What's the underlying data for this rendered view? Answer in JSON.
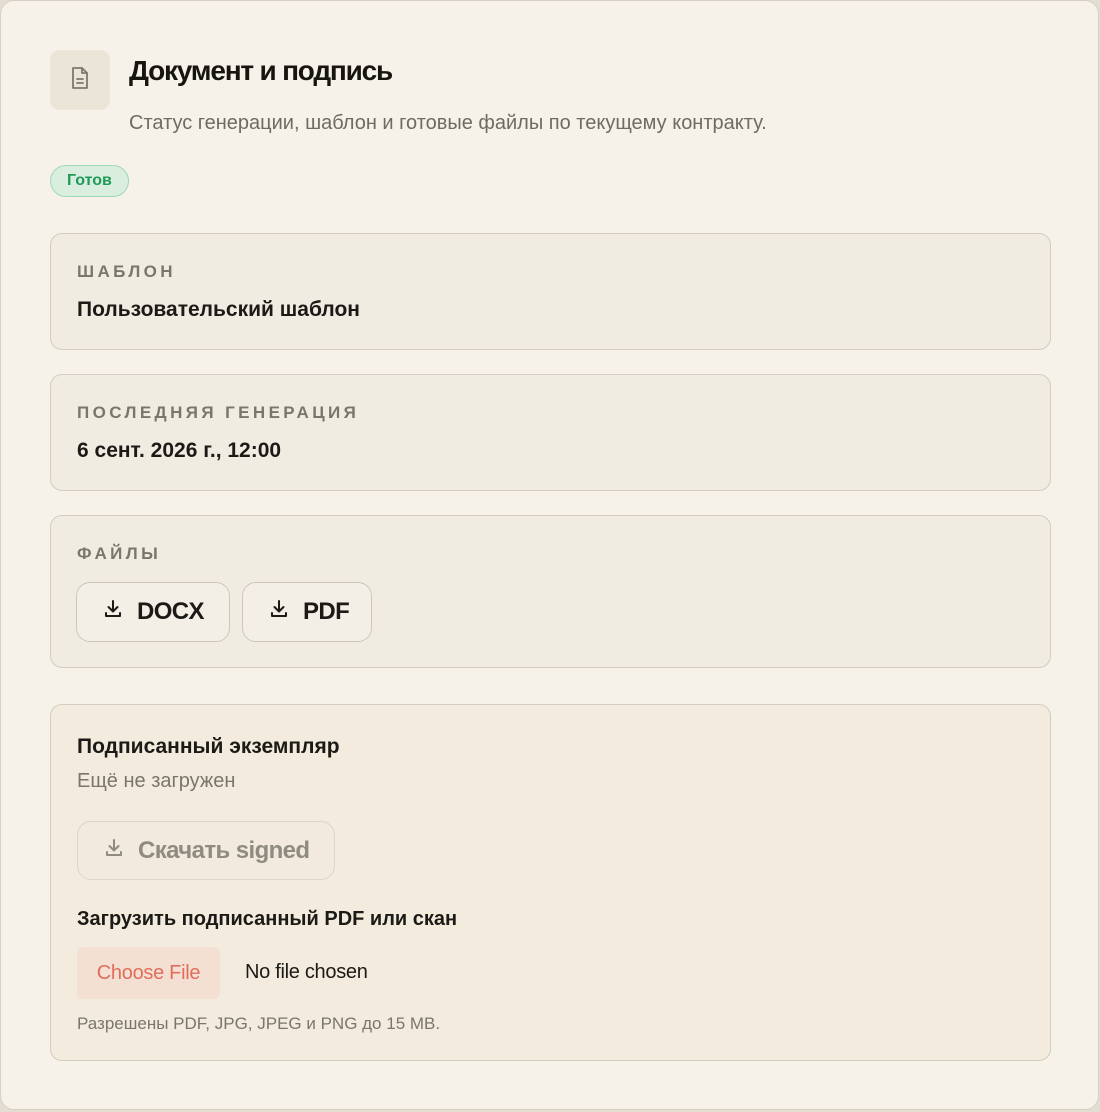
{
  "header": {
    "icon": "file-text-icon",
    "title": "Документ и подпись",
    "subtitle": "Статус генерации, шаблон и готовые файлы по текущему контракту."
  },
  "status": {
    "label": "Готов",
    "color": "#1e9a57"
  },
  "template_card": {
    "label": "ШАБЛОН",
    "value": "Пользовательский шаблон"
  },
  "generation_card": {
    "label": "ПОСЛЕДНЯЯ ГЕНЕРАЦИЯ",
    "value": "6 сент. 2026 г., 12:00"
  },
  "files_card": {
    "label": "ФАЙЛЫ",
    "buttons": [
      {
        "label": "DOCX",
        "icon": "download-icon"
      },
      {
        "label": "PDF",
        "icon": "download-icon"
      }
    ]
  },
  "signed_card": {
    "title": "Подписанный экземпляр",
    "status": "Ещё не загружен",
    "download_label": "Скачать signed",
    "upload_label": "Загрузить подписанный PDF или скан",
    "choose_file_label": "Choose File",
    "no_file_text": "No file chosen",
    "hint": "Разрешены PDF, JPG, JPEG и PNG до 15 MB."
  }
}
